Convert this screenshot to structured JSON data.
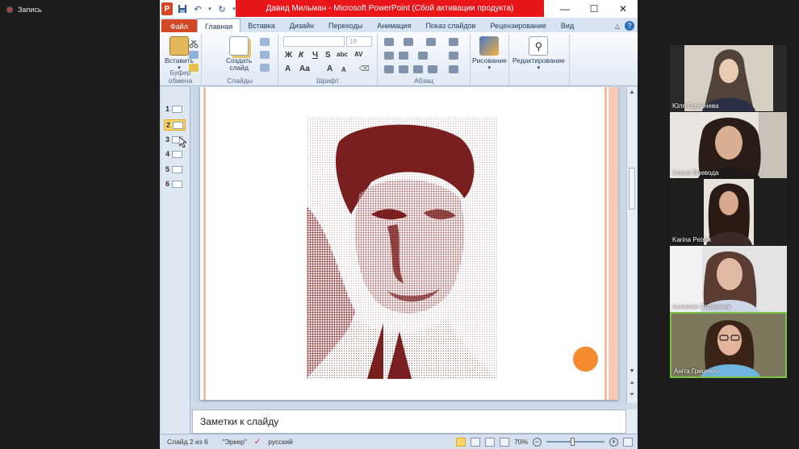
{
  "recording": {
    "label": "Запись"
  },
  "window": {
    "title": "Давид Мильман  -  Microsoft PowerPoint (Сбой активации продукта)"
  },
  "ribbon": {
    "file_tab": "Файл",
    "tabs": [
      "Главная",
      "Вставка",
      "Дизайн",
      "Переходы",
      "Анимация",
      "Показ слайдов",
      "Рецензирование",
      "Вид"
    ],
    "active_tab": "Главная",
    "clipboard": {
      "paste": "Вставить",
      "group": "Буфер обмена"
    },
    "slides": {
      "new_slide_line1": "Создать",
      "new_slide_line2": "слайд",
      "group": "Слайды"
    },
    "font": {
      "size": "18",
      "group": "Шрифт",
      "buttons": [
        "Ж",
        "К",
        "Ч",
        "S",
        "abc",
        "AV",
        "A",
        "Aa",
        "A",
        "A"
      ]
    },
    "paragraph": {
      "group": "Абзац"
    },
    "drawing": {
      "label": "Рисование"
    },
    "editing": {
      "label": "Редактирование"
    }
  },
  "thumbnails": [
    {
      "num": "1",
      "selected": false
    },
    {
      "num": "2",
      "selected": true
    },
    {
      "num": "3",
      "selected": false
    },
    {
      "num": "4",
      "selected": false
    },
    {
      "num": "5",
      "selected": false
    },
    {
      "num": "6",
      "selected": false
    }
  ],
  "slide": {
    "accent_color": "#f28a2f",
    "stripe_color": "#f3b9a1",
    "photo_tint": "#7a1f1f"
  },
  "notes": {
    "placeholder": "Заметки к слайду"
  },
  "status": {
    "slide_info": "Слайд 2 из 6",
    "theme": "\"Эркер\"",
    "language": "русский",
    "zoom": "70%",
    "zoom_fraction": 0.45
  },
  "participants": [
    {
      "name": "Юля Горбачева"
    },
    {
      "name": "Алина Воевода"
    },
    {
      "name": "Karina Petruk"
    },
    {
      "name": "Ангеліна Стрельчук"
    },
    {
      "name": "Аніта Гриценко",
      "active": true
    }
  ]
}
